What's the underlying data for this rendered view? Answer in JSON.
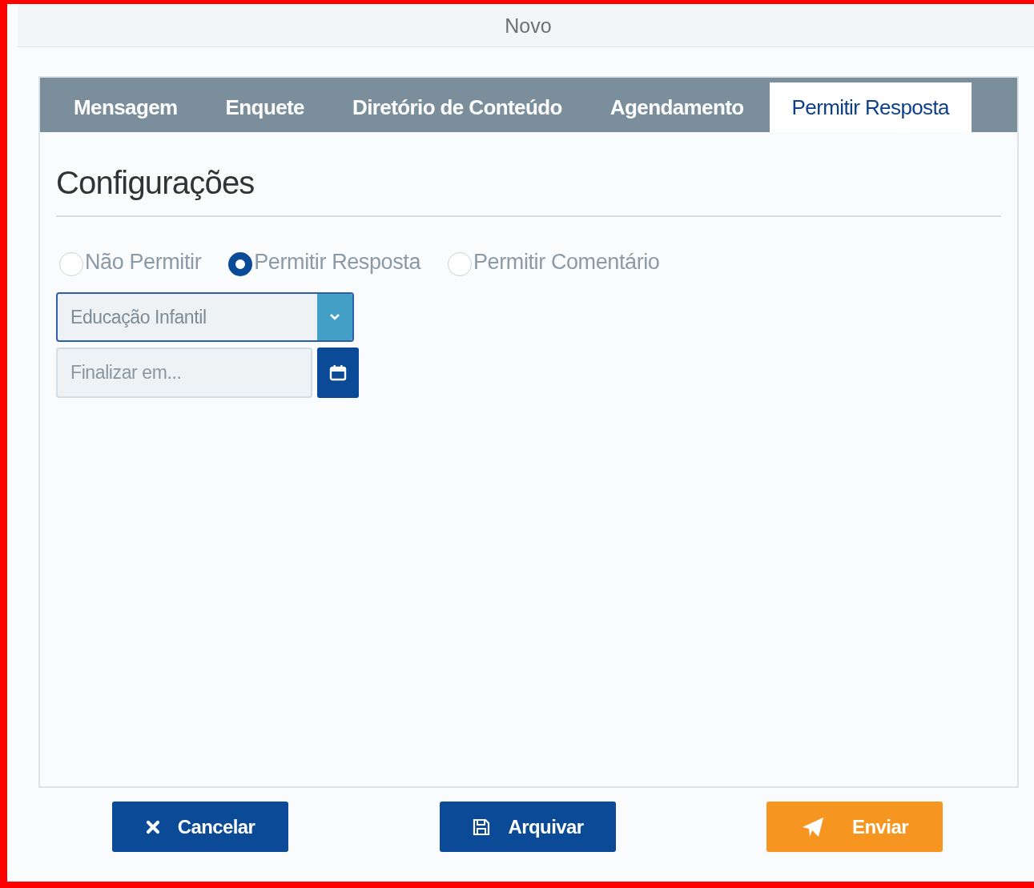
{
  "dialog": {
    "title": "Novo"
  },
  "tabs": [
    {
      "label": "Mensagem",
      "selected": false
    },
    {
      "label": "Enquete",
      "selected": false
    },
    {
      "label": "Diretório de Conteúdo",
      "selected": false
    },
    {
      "label": "Agendamento",
      "selected": false
    },
    {
      "label": "Permitir Resposta",
      "selected": true
    }
  ],
  "section": {
    "heading": "Configurações"
  },
  "reply_options": [
    {
      "label": "Não Permitir",
      "selected": false
    },
    {
      "label": "Permitir Resposta",
      "selected": true
    },
    {
      "label": "Permitir Comentário",
      "selected": false
    }
  ],
  "audience_select": {
    "value": "Educação Infantil"
  },
  "end_date": {
    "placeholder": "Finalizar em..."
  },
  "buttons": [
    {
      "label": "Cancelar",
      "kind": "cancel"
    },
    {
      "label": "Arquivar",
      "kind": "archive"
    },
    {
      "label": "Enviar",
      "kind": "send"
    }
  ]
}
